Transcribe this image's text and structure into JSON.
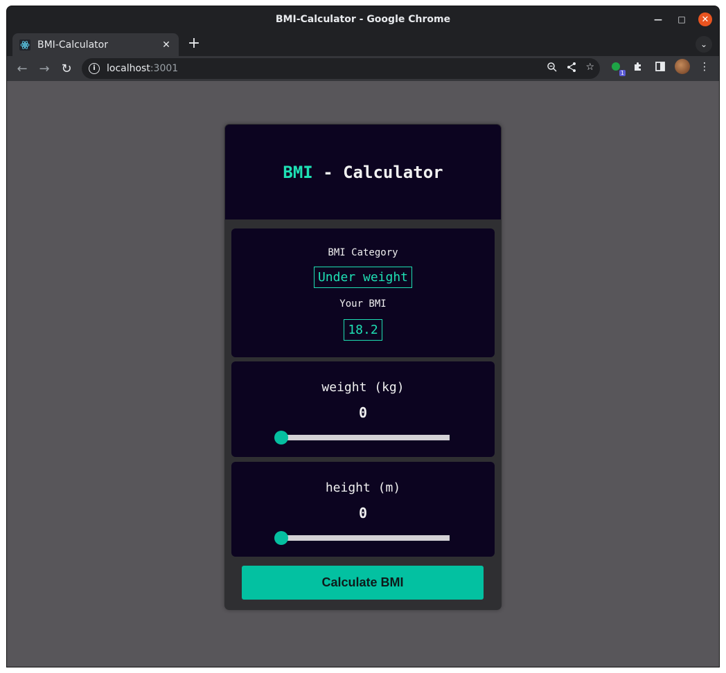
{
  "window": {
    "title": "BMI-Calculator - Google Chrome"
  },
  "tab": {
    "title": "BMI-Calculator"
  },
  "address": {
    "host": "localhost",
    "port": ":3001"
  },
  "extensions": {
    "badge": "1"
  },
  "app": {
    "title_accent": "BMI",
    "title_rest": " - Calculator",
    "category_label": "BMI Category",
    "category_value": "Under weight",
    "bmi_label": "Your BMI",
    "bmi_value": "18.2",
    "weight_label": "weight (kg)",
    "weight_value": "0",
    "weight_fraction": 0,
    "height_label": "height (m)",
    "height_value": "0",
    "height_fraction": 0,
    "calculate_label": "Calculate BMI",
    "accent_color": "#1ee0b4",
    "button_color": "#03c1a1"
  }
}
